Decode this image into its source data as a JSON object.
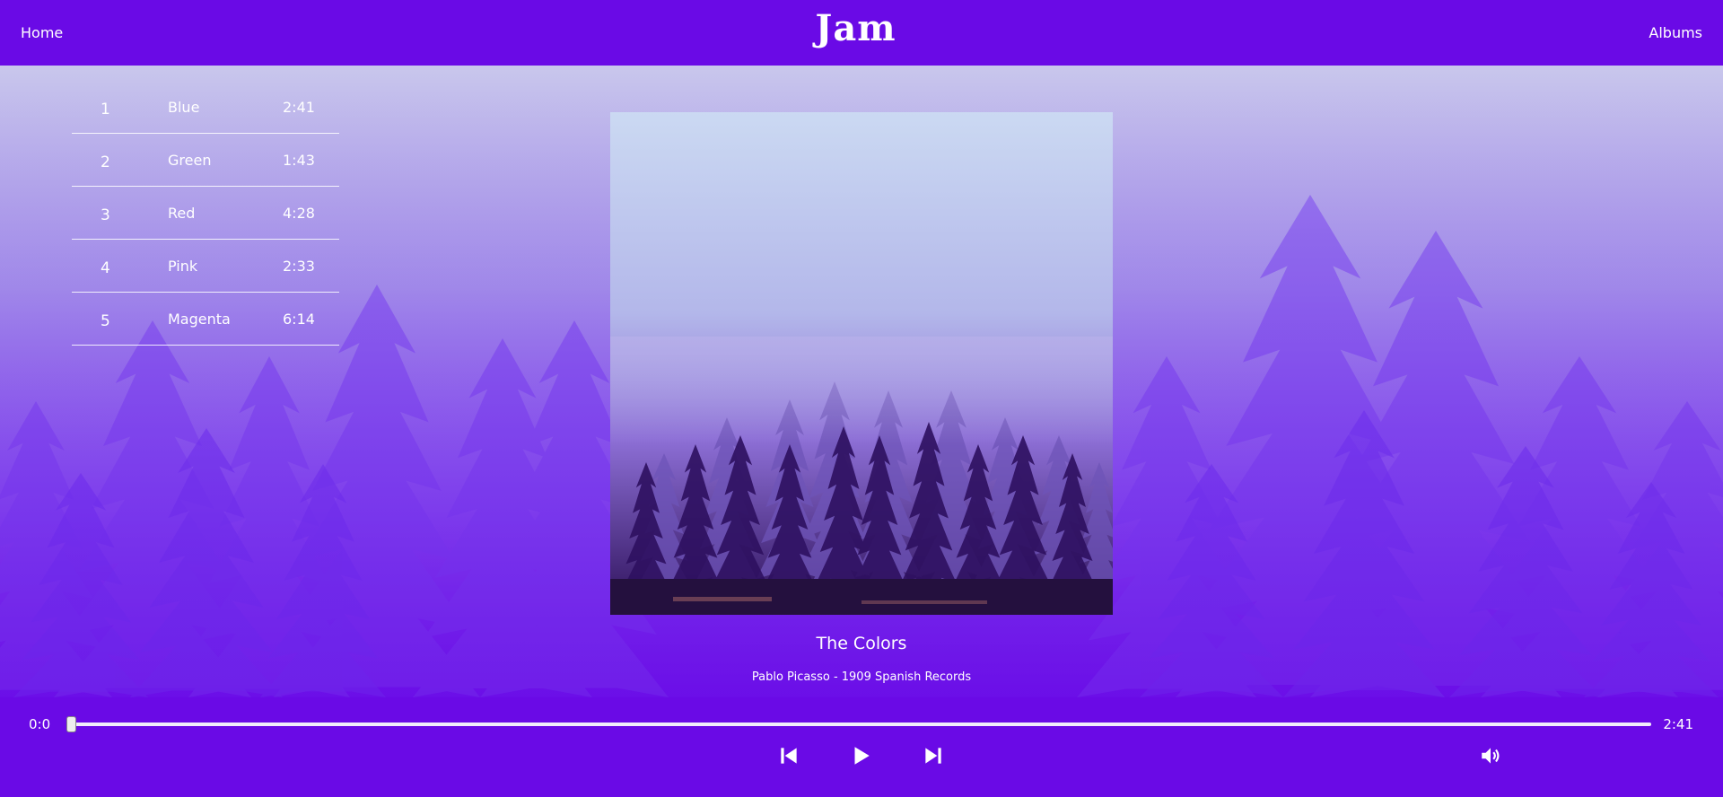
{
  "header": {
    "home_label": "Home",
    "logo_text": "Jam",
    "albums_label": "Albums"
  },
  "tracks": [
    {
      "num": "1",
      "title": "Blue",
      "duration": "2:41"
    },
    {
      "num": "2",
      "title": "Green",
      "duration": "1:43"
    },
    {
      "num": "3",
      "title": "Red",
      "duration": "4:28"
    },
    {
      "num": "4",
      "title": "Pink",
      "duration": "2:33"
    },
    {
      "num": "5",
      "title": "Magenta",
      "duration": "6:14"
    }
  ],
  "album": {
    "title": "The Colors",
    "subtitle": "Pablo Picasso - 1909 Spanish Records"
  },
  "player": {
    "current_time": "0:0",
    "total_time": "2:41",
    "progress": 0.0
  },
  "icons": {
    "prev": "skip-previous-icon",
    "play": "play-icon",
    "next": "skip-next-icon",
    "volume": "volume-icon"
  },
  "colors": {
    "brand": "#6a0ae6",
    "text": "#ffffff"
  }
}
